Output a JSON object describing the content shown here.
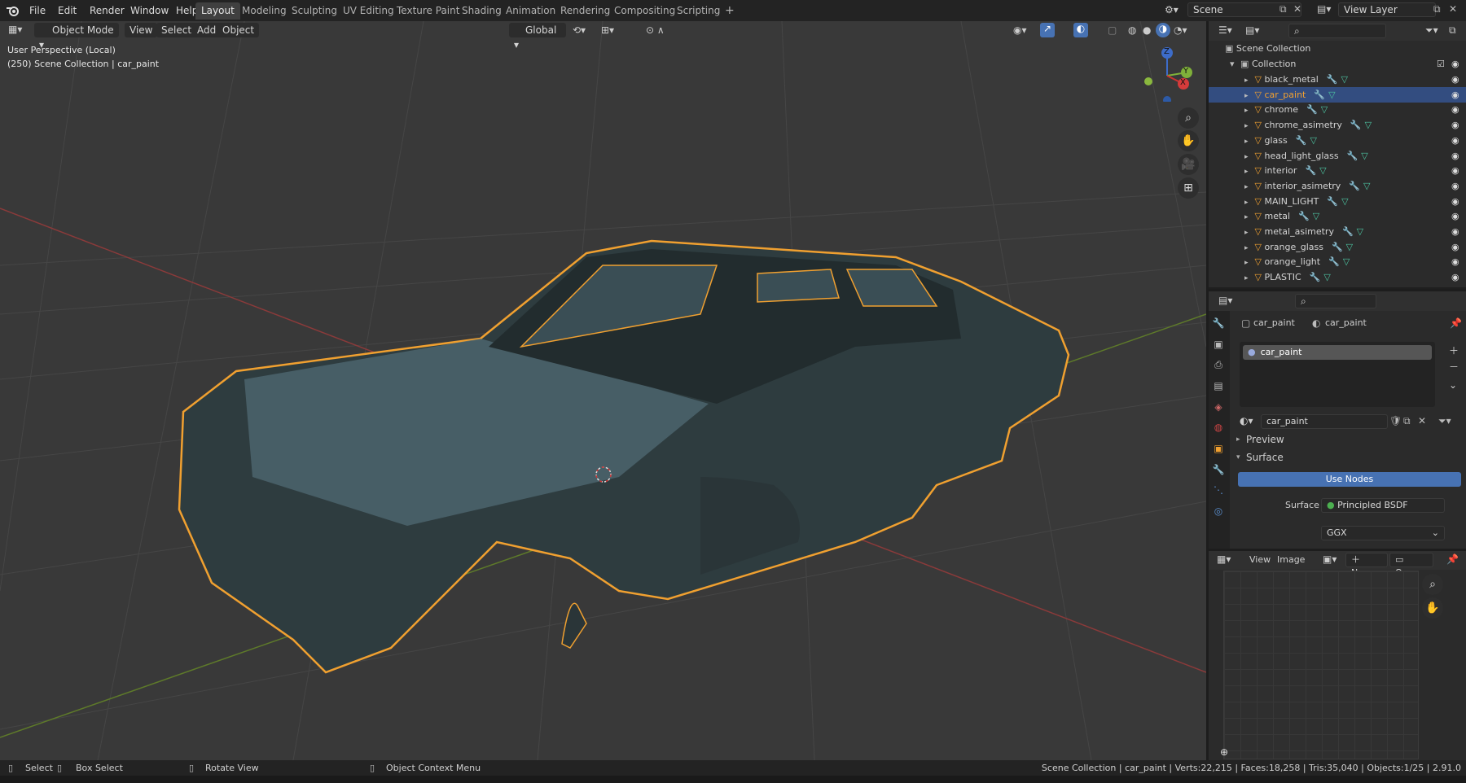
{
  "topbar": {
    "menus": [
      "File",
      "Edit",
      "Render",
      "Window",
      "Help"
    ],
    "workspaces": [
      "Layout",
      "Modeling",
      "Sculpting",
      "UV Editing",
      "Texture Paint",
      "Shading",
      "Animation",
      "Rendering",
      "Compositing",
      "Scripting"
    ],
    "active_workspace": "Layout",
    "add_tab": "+",
    "scene": "Scene",
    "view_layer": "View Layer"
  },
  "viewport": {
    "mode": "Object Mode",
    "menus": [
      "View",
      "Select",
      "Add",
      "Object"
    ],
    "orientation": "Global",
    "info_line1": "User Perspective (Local)",
    "info_line2": "(250) Scene Collection | car_paint",
    "gizmo": {
      "z": "Z",
      "y": "Y",
      "x": "X"
    }
  },
  "outliner": {
    "root": "Scene Collection",
    "collection": "Collection",
    "items": [
      {
        "name": "black_metal",
        "selected": false
      },
      {
        "name": "car_paint",
        "selected": true
      },
      {
        "name": "chrome",
        "selected": false
      },
      {
        "name": "chrome_asimetry",
        "selected": false
      },
      {
        "name": "glass",
        "selected": false
      },
      {
        "name": "head_light_glass",
        "selected": false
      },
      {
        "name": "interior",
        "selected": false
      },
      {
        "name": "interior_asimetry",
        "selected": false
      },
      {
        "name": "MAIN_LIGHT",
        "selected": false
      },
      {
        "name": "metal",
        "selected": false
      },
      {
        "name": "metal_asimetry",
        "selected": false
      },
      {
        "name": "orange_glass",
        "selected": false
      },
      {
        "name": "orange_light",
        "selected": false
      },
      {
        "name": "PLASTIC",
        "selected": false
      }
    ]
  },
  "properties": {
    "breadcrumb_object": "car_paint",
    "breadcrumb_material": "car_paint",
    "slot": "car_paint",
    "material_name": "car_paint",
    "preview_label": "Preview",
    "surface_label": "Surface",
    "use_nodes": "Use Nodes",
    "surface_field_label": "Surface",
    "surface_value": "Principled BSDF",
    "distribution": "GGX"
  },
  "image_editor": {
    "menus": [
      "View",
      "Image"
    ],
    "new_label": "New",
    "open_label": "Open"
  },
  "statusbar": {
    "select": "Select",
    "box_select": "Box Select",
    "rotate": "Rotate View",
    "context": "Object Context Menu",
    "stats": "Scene Collection | car_paint | Verts:22,215 | Faces:18,258 | Tris:35,040 | Objects:1/25 | 2.91.0"
  },
  "colors": {
    "accent": "#4772b3",
    "selection_outline": "#f0a030",
    "selected_row": "#334d80"
  }
}
